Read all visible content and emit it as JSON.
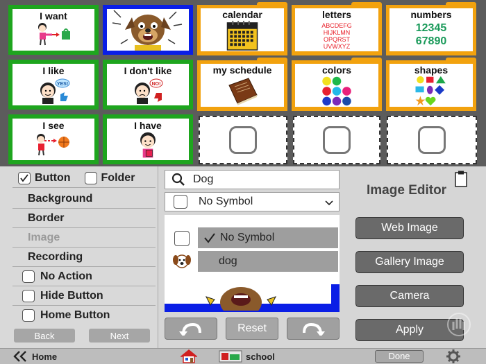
{
  "grid": {
    "i_want": "I want",
    "i_like": "I like",
    "i_dont_like": "I don't like",
    "i_see": "I see",
    "i_have": "I have",
    "calendar": "calendar",
    "letters": "letters",
    "letters_lines": [
      "ABCDEFG",
      "HIJKLMN",
      "OPQRST",
      "UVWXYZ"
    ],
    "numbers": "numbers",
    "numbers_lines": [
      "12345",
      "67890"
    ],
    "my_schedule": "my schedule",
    "colors": "colors",
    "shapes": "shapes",
    "bubble_yes": "YES!",
    "bubble_no": "NO!"
  },
  "left": {
    "button_label": "Button",
    "folder_label": "Folder",
    "background": "Background",
    "border": "Border",
    "image": "Image",
    "recording": "Recording",
    "no_action": "No Action",
    "hide_button": "Hide Button",
    "home_button": "Home Button",
    "back": "Back",
    "next": "Next"
  },
  "mid": {
    "search_value": "Dog",
    "symbol_select": "No Symbol",
    "option_no_symbol": "No Symbol",
    "option_dog": "dog",
    "reset": "Reset"
  },
  "right": {
    "title": "Image Editor",
    "web_image": "Web Image",
    "gallery_image": "Gallery Image",
    "camera": "Camera",
    "apply": "Apply"
  },
  "bottom": {
    "home": "Home",
    "school": "school",
    "done": "Done"
  },
  "colors": {
    "green_border": "#1ea51e",
    "blue_border": "#0a1ee6",
    "folder_orange": "#f2a20e",
    "numbers_green": "#1a9a5a",
    "letters_red": "#e8202a"
  }
}
